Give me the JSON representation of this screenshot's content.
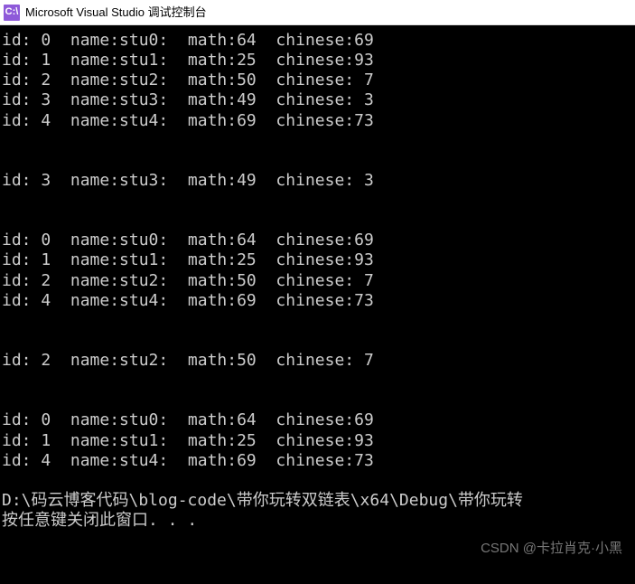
{
  "titlebar": {
    "icon_text": "C:\\",
    "title": "Microsoft Visual Studio 调试控制台"
  },
  "blocks": [
    [
      {
        "id": " 0",
        "name": "stu0",
        "math": "64",
        "chinese": "69"
      },
      {
        "id": " 1",
        "name": "stu1",
        "math": "25",
        "chinese": "93"
      },
      {
        "id": " 2",
        "name": "stu2",
        "math": "50",
        "chinese": " 7"
      },
      {
        "id": " 3",
        "name": "stu3",
        "math": "49",
        "chinese": " 3"
      },
      {
        "id": " 4",
        "name": "stu4",
        "math": "69",
        "chinese": "73"
      }
    ],
    [
      {
        "id": " 3",
        "name": "stu3",
        "math": "49",
        "chinese": " 3"
      }
    ],
    [
      {
        "id": " 0",
        "name": "stu0",
        "math": "64",
        "chinese": "69"
      },
      {
        "id": " 1",
        "name": "stu1",
        "math": "25",
        "chinese": "93"
      },
      {
        "id": " 2",
        "name": "stu2",
        "math": "50",
        "chinese": " 7"
      },
      {
        "id": " 4",
        "name": "stu4",
        "math": "69",
        "chinese": "73"
      }
    ],
    [
      {
        "id": " 2",
        "name": "stu2",
        "math": "50",
        "chinese": " 7"
      }
    ],
    [
      {
        "id": " 0",
        "name": "stu0",
        "math": "64",
        "chinese": "69"
      },
      {
        "id": " 1",
        "name": "stu1",
        "math": "25",
        "chinese": "93"
      },
      {
        "id": " 4",
        "name": "stu4",
        "math": "69",
        "chinese": "73"
      }
    ]
  ],
  "footer": {
    "path": "D:\\码云博客代码\\blog-code\\带你玩转双链表\\x64\\Debug\\带你玩转",
    "prompt": "按任意键关闭此窗口. . ."
  },
  "labels": {
    "id": "id:",
    "name": "name:",
    "math": "math:",
    "chinese": "chinese:"
  },
  "watermark": "CSDN @卡拉肖克·小黑"
}
